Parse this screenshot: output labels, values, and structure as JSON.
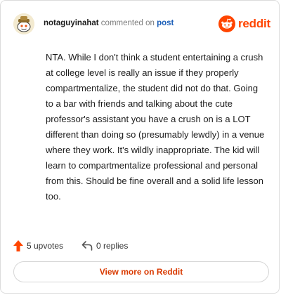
{
  "comment": {
    "username": "notaguyinahat",
    "commented_on_text": "commented on",
    "post_link_label": "post",
    "brand": "reddit",
    "body": "NTA. While I don't think a student entertaining a crush at college level is really an issue if they properly compartmentalize, the student did not do that. Going to a bar with friends and talking about the cute professor's assistant you have a crush on is a LOT different than doing so (presumably lewdly) in a venue where they work. It's wildly inappropriate. The kid will learn to compartmentalize professional and personal from this. Should be fine overall and a solid life lesson too."
  },
  "actions": {
    "upvotes_label": "5 upvotes",
    "replies_label": "0 replies"
  },
  "footer": {
    "view_more_label": "View more on Reddit"
  },
  "icons": {
    "avatar": "snoo-avatar-icon",
    "logo": "reddit-logo-icon",
    "upvote": "upvote-arrow-icon",
    "reply": "reply-arrow-icon"
  },
  "colors": {
    "brand": "#ff4500",
    "link": "#1c5fb8",
    "view_more": "#d93a00"
  }
}
